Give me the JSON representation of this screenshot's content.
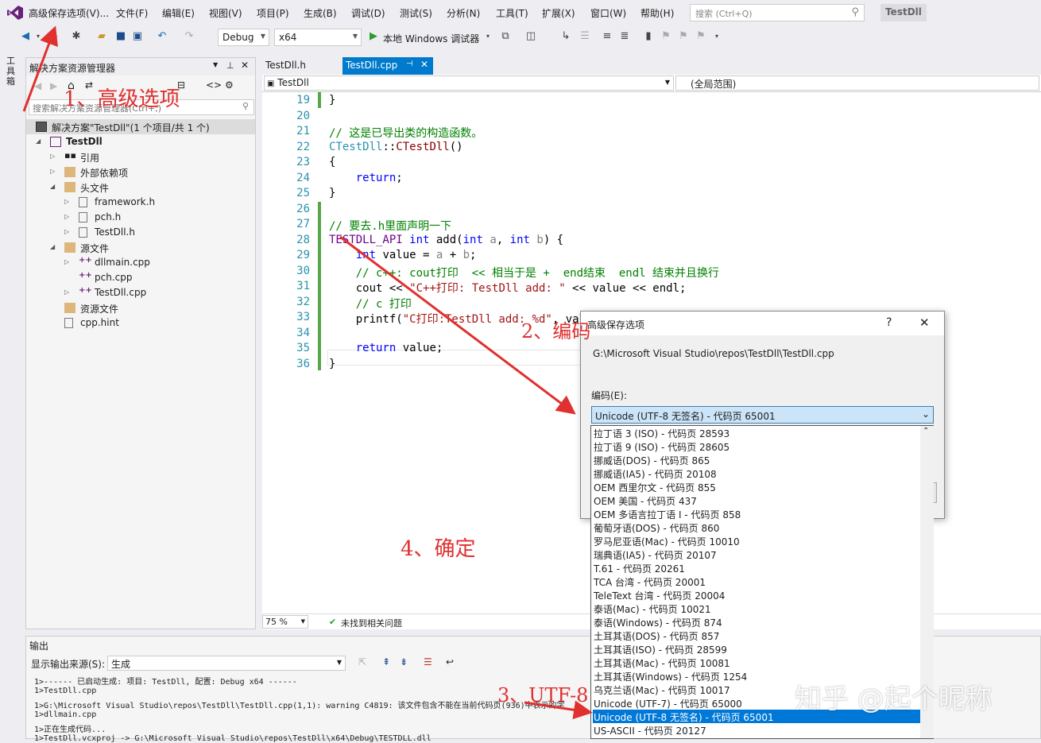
{
  "menubar": {
    "items": [
      "高级保存选项(V)...",
      "文件(F)",
      "编辑(E)",
      "视图(V)",
      "项目(P)",
      "生成(B)",
      "调试(D)",
      "测试(S)",
      "分析(N)",
      "工具(T)",
      "扩展(X)",
      "窗口(W)",
      "帮助(H)"
    ],
    "search_placeholder": "搜索 (Ctrl+Q)",
    "app_name": "TestDll"
  },
  "toolbar": {
    "config": "Debug",
    "platform": "x64",
    "run_label": "本地 Windows 调试器"
  },
  "left_strip": {
    "label": "工具箱"
  },
  "solution_explorer": {
    "title": "解决方案资源管理器",
    "search_placeholder": "搜索解决方案资源管理器(Ctrl+;)",
    "items": [
      {
        "label": "解决方案\"TestDll\"(1 个项目/共 1 个)"
      },
      {
        "label": "TestDll"
      },
      {
        "label": "引用"
      },
      {
        "label": "外部依赖项"
      },
      {
        "label": "头文件"
      },
      {
        "label": "framework.h"
      },
      {
        "label": "pch.h"
      },
      {
        "label": "TestDll.h"
      },
      {
        "label": "源文件"
      },
      {
        "label": "dllmain.cpp"
      },
      {
        "label": "pch.cpp"
      },
      {
        "label": "TestDll.cpp"
      },
      {
        "label": "资源文件"
      },
      {
        "label": "cpp.hint"
      }
    ]
  },
  "editor": {
    "tabs": [
      {
        "label": "TestDll.h"
      },
      {
        "label": "TestDll.cpp"
      }
    ],
    "nav_left": "TestDll",
    "nav_right": "(全局范围)",
    "line_numbers": [
      "19",
      "20",
      "21",
      "22",
      "23",
      "24",
      "25",
      "26",
      "27",
      "28",
      "29",
      "30",
      "31",
      "32",
      "33",
      "34",
      "35",
      "36"
    ],
    "zoom": "75 %",
    "status": "未找到相关问题"
  },
  "output": {
    "title": "输出",
    "source_label": "显示输出来源(S):",
    "source_value": "生成",
    "lines": [
      "1>------ 已启动生成: 项目: TestDll, 配置: Debug x64 ------",
      "1>TestDll.cpp",
      "1>G:\\Microsoft Visual Studio\\repos\\TestDll\\TestDll.cpp(1,1): warning C4819: 该文件包含不能在当前代码页(936)中表示的字",
      "1>dllmain.cpp",
      "1>正在生成代码...",
      "1>TestDll.vcxproj -> G:\\Microsoft Visual Studio\\repos\\TestDll\\x64\\Debug\\TESTDLL.dll"
    ]
  },
  "dialog": {
    "title": "高级保存选项",
    "help": "?",
    "close": "✕",
    "path": "G:\\Microsoft Visual Studio\\repos\\TestDll\\TestDll.cpp",
    "encoding_label": "编码(E):",
    "encoding_value": "Unicode (UTF-8 无签名) - 代码页 65001"
  },
  "encoding_list": {
    "items": [
      "拉丁语 3 (ISO) - 代码页 28593",
      "拉丁语 9 (ISO) - 代码页 28605",
      "挪威语(DOS) - 代码页 865",
      "挪威语(IA5) - 代码页 20108",
      "OEM 西里尔文 - 代码页 855",
      "OEM 美国 - 代码页 437",
      "OEM 多语言拉丁语 I - 代码页 858",
      "葡萄牙语(DOS) - 代码页 860",
      "罗马尼亚语(Mac) - 代码页 10010",
      "瑞典语(IA5) - 代码页 20107",
      "T.61 - 代码页 20261",
      "TCA 台湾 - 代码页 20001",
      "TeleText 台湾 - 代码页 20004",
      "泰语(Mac) - 代码页 10021",
      "泰语(Windows) - 代码页 874",
      "土耳其语(DOS) - 代码页 857",
      "土耳其语(ISO) - 代码页 28599",
      "土耳其语(Mac) - 代码页 10081",
      "土耳其语(Windows) - 代码页 1254",
      "乌克兰语(Mac) - 代码页 10017",
      "Unicode (UTF-7) - 代码页 65000",
      "Unicode (UTF-8 无签名) - 代码页 65001",
      "US-ASCII - 代码页 20127"
    ],
    "selected_index": 21
  },
  "annotations": {
    "a1": "1、高级选项",
    "a2": "2、编码",
    "a3": "3、UTF-8",
    "a4": "4、确定",
    "watermark": "知乎 @起个昵称"
  },
  "colors": {
    "accent": "#007acc",
    "annotation": "#e03030",
    "selection": "#0078d7"
  }
}
